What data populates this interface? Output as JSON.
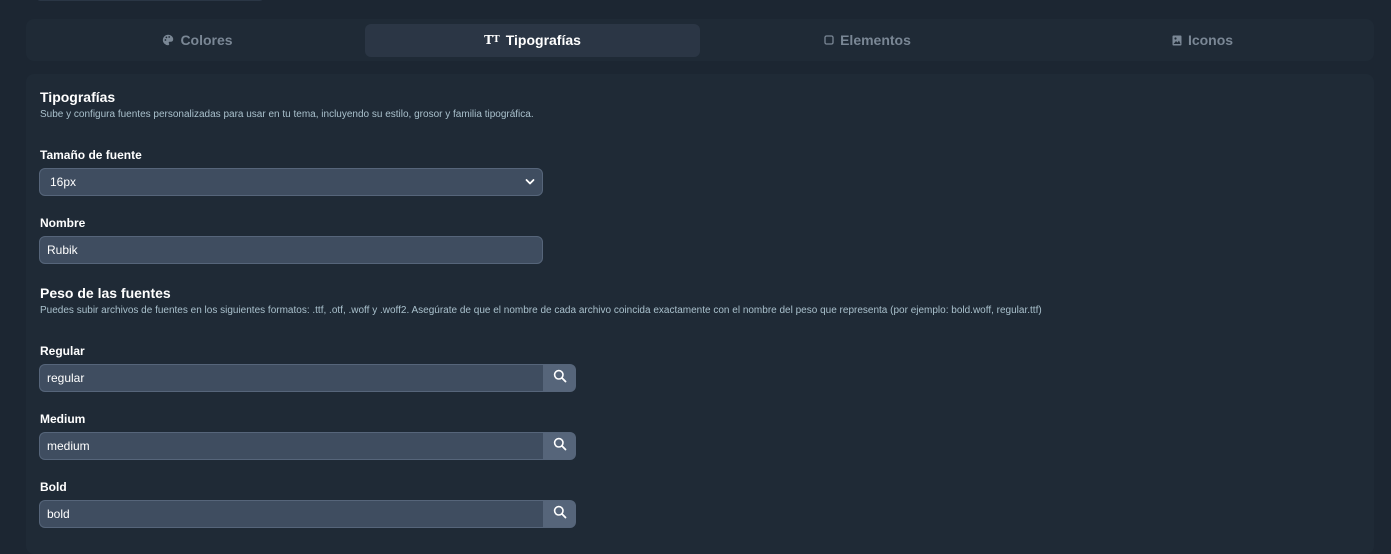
{
  "tabs": [
    {
      "label": "Colores",
      "icon": "palette-icon"
    },
    {
      "label": "Tipografías",
      "icon": "typography-icon",
      "active": true
    },
    {
      "label": "Elementos",
      "icon": "square-icon"
    },
    {
      "label": "Iconos",
      "icon": "image-icon"
    }
  ],
  "typography": {
    "title": "Tipografías",
    "description": "Sube y configura fuentes personalizadas para usar en tu tema, incluyendo su estilo, grosor y familia tipográfica.",
    "font_size_label": "Tamaño de fuente",
    "font_size_value": "16px",
    "name_label": "Nombre",
    "name_value": "Rubik"
  },
  "weights": {
    "title": "Peso de las fuentes",
    "description": "Puedes subir archivos de fuentes en los siguientes formatos: .ttf, .otf, .woff y .woff2. Asegúrate de que el nombre de cada archivo coincida exactamente con el nombre del peso que representa (por ejemplo: bold.woff, regular.ttf)",
    "items": [
      {
        "label": "Regular",
        "value": "regular"
      },
      {
        "label": "Medium",
        "value": "medium"
      },
      {
        "label": "Bold",
        "value": "bold"
      }
    ]
  }
}
